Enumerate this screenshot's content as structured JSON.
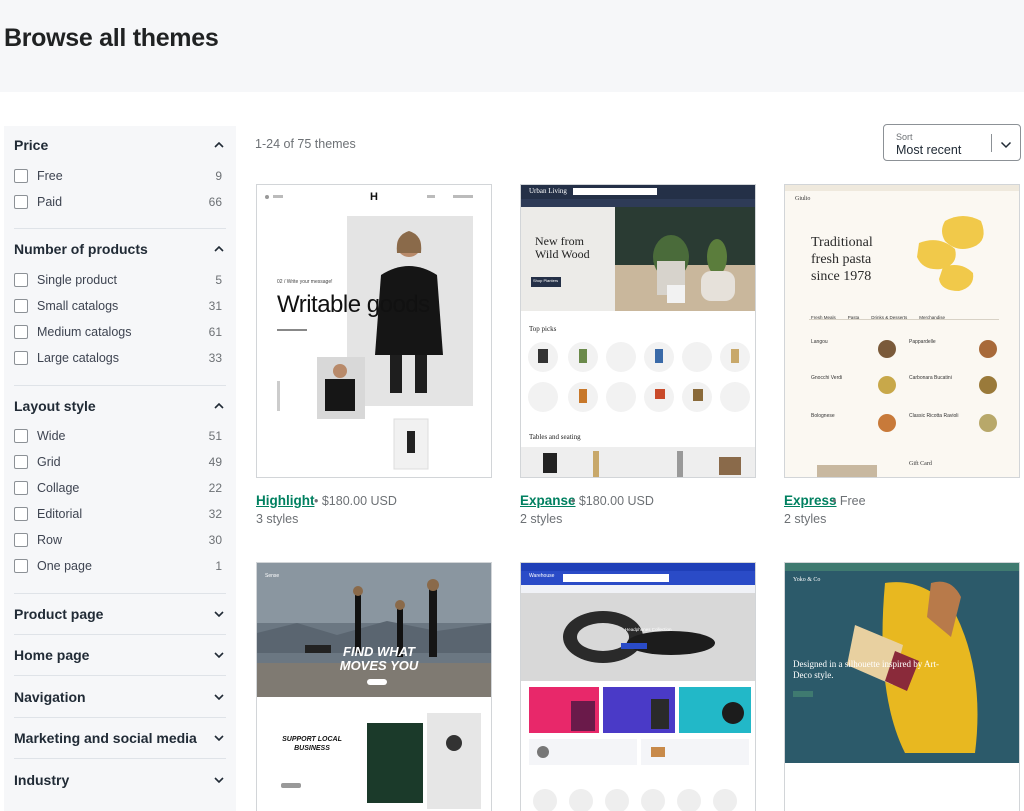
{
  "page": {
    "title": "Browse all themes"
  },
  "results": {
    "count_label": "1-24 of 75 themes"
  },
  "sort": {
    "label": "Sort",
    "value": "Most recent"
  },
  "filters": {
    "price": {
      "title": "Price",
      "options": [
        {
          "label": "Free",
          "count": "9"
        },
        {
          "label": "Paid",
          "count": "66"
        }
      ]
    },
    "products": {
      "title": "Number of products",
      "options": [
        {
          "label": "Single product",
          "count": "5"
        },
        {
          "label": "Small catalogs",
          "count": "31"
        },
        {
          "label": "Medium catalogs",
          "count": "61"
        },
        {
          "label": "Large catalogs",
          "count": "33"
        }
      ]
    },
    "layout": {
      "title": "Layout style",
      "options": [
        {
          "label": "Wide",
          "count": "51"
        },
        {
          "label": "Grid",
          "count": "49"
        },
        {
          "label": "Collage",
          "count": "22"
        },
        {
          "label": "Editorial",
          "count": "32"
        },
        {
          "label": "Row",
          "count": "30"
        },
        {
          "label": "One page",
          "count": "1"
        }
      ]
    },
    "collapsed": [
      "Product page",
      "Home page",
      "Navigation",
      "Marketing and social media",
      "Industry"
    ]
  },
  "themes": [
    {
      "name": "Highlight",
      "price": " • $180.00 USD",
      "styles": "3 styles",
      "preview": {
        "headline": "Writable goods",
        "tagline": "02 / Write your message!",
        "logo": "H"
      }
    },
    {
      "name": "Expanse",
      "price": " • $180.00 USD",
      "styles": "2 styles",
      "preview": {
        "brand": "Urban Living",
        "headline": "New from Wild Wood",
        "section1": "Top picks",
        "section2": "Tables and seating",
        "cta": "Shop Planters"
      }
    },
    {
      "name": "Express",
      "price": " • Free",
      "styles": "2 styles",
      "preview": {
        "brand": "Giulio",
        "headline": "Traditional fresh pasta since 1978",
        "tabs": [
          "Fresh Meals",
          "Pasta",
          "Drinks & Desserts",
          "Merchandise"
        ],
        "items": [
          "Langou",
          "Pappardelle",
          "Gnocchi Verdi",
          "Carbonara Bucatini",
          "Bolognese",
          "Classic Ricotta Ravioli"
        ],
        "footer": "Gift Card"
      }
    },
    {
      "name": "",
      "price": "",
      "styles": "",
      "preview": {
        "headline": "FIND WHAT MOVES YOU",
        "subhead": "SUPPORT LOCAL BUSINESS",
        "brand": "Sense"
      }
    },
    {
      "name": "",
      "price": "",
      "styles": "",
      "preview": {
        "brand": "Warehouse",
        "banner": "Headphones Collection"
      }
    },
    {
      "name": "",
      "price": "",
      "styles": "",
      "preview": {
        "brand": "Yoko & Co",
        "headline": "Designed in a silhouette inspired by Art-Deco style."
      }
    }
  ],
  "colors": {
    "accent": "#008060",
    "sidebar_bg": "#f6f7f9",
    "text": "#212b36",
    "muted": "#6d7175"
  }
}
